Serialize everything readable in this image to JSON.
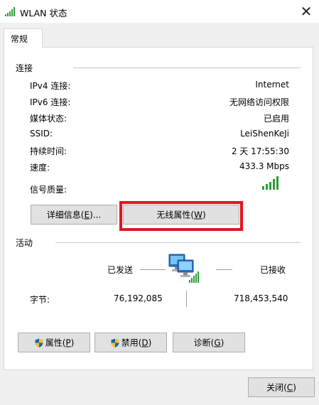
{
  "window": {
    "title": "WLAN 状态",
    "close_glyph": "✕"
  },
  "tab": {
    "label": "常规"
  },
  "connection": {
    "section_label": "连接",
    "rows": [
      {
        "label": "IPv4 连接:",
        "value": "Internet"
      },
      {
        "label": "IPv6 连接:",
        "value": "无网络访问权限"
      },
      {
        "label": "媒体状态:",
        "value": "已启用"
      },
      {
        "label": "SSID:",
        "value": "LeiShenKeJi"
      },
      {
        "label": "持续时间:",
        "value": "2 天 17:55:30"
      },
      {
        "label": "速度:",
        "value": "433.3 Mbps"
      }
    ],
    "signal_label": "信号质量:",
    "signal_bars": 5,
    "details_button": {
      "text": "详细信息(",
      "key": "E",
      "suffix": ")..."
    },
    "wireless_props_button": {
      "text": "无线属性(",
      "key": "W",
      "suffix": ")"
    }
  },
  "activity": {
    "section_label": "活动",
    "sent_label": "已发送",
    "received_label": "已接收",
    "bytes_label": "字节:",
    "bytes_sent": "76,192,085",
    "bytes_received": "718,453,540"
  },
  "buttons": {
    "properties": {
      "text": "属性(",
      "key": "P",
      "suffix": ")"
    },
    "disable": {
      "text": "禁用(",
      "key": "D",
      "suffix": ")"
    },
    "diagnose": {
      "text": "诊断(",
      "key": "G",
      "suffix": ")"
    },
    "close": {
      "text": "关闭(",
      "key": "C",
      "suffix": ")"
    }
  },
  "colors": {
    "highlight": "#e5151e",
    "signal_green": "#2e9e3a"
  }
}
